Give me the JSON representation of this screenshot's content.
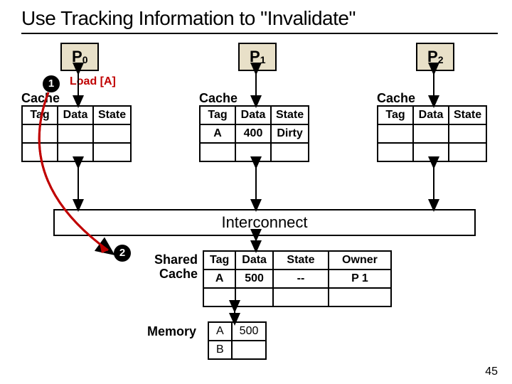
{
  "title": "Use Tracking Information to \"Invalidate\"",
  "processors": {
    "p0": "P",
    "p0_sub": "0",
    "p1": "P",
    "p1_sub": "1",
    "p2": "P",
    "p2_sub": "2"
  },
  "labels": {
    "load_a": "Load [A]",
    "cache0": "Cache",
    "cache1": "Cache",
    "cache2": "Cache",
    "interconnect": "Interconnect",
    "shared_cache": "Shared\nCache",
    "memory": "Memory"
  },
  "steps": {
    "one": "1",
    "two": "2"
  },
  "cache_headers": {
    "tag": "Tag",
    "data": "Data",
    "state": "State"
  },
  "cache0": {
    "r1_tag": "",
    "r1_data": "",
    "r1_state": "",
    "r2_tag": "",
    "r2_data": "",
    "r2_state": ""
  },
  "cache1": {
    "r1_tag": "A",
    "r1_data": "400",
    "r1_state": "Dirty",
    "r2_tag": "",
    "r2_data": "",
    "r2_state": ""
  },
  "cache2": {
    "r1_tag": "",
    "r1_data": "",
    "r1_state": "",
    "r2_tag": "",
    "r2_data": "",
    "r2_state": ""
  },
  "shared_headers": {
    "tag": "Tag",
    "data": "Data",
    "state": "State",
    "owner": "Owner"
  },
  "shared": {
    "r1_tag": "A",
    "r1_data": "500",
    "r1_state": "--",
    "r1_owner": "P 1",
    "r2_tag": "",
    "r2_data": "",
    "r2_state": "",
    "r2_owner": ""
  },
  "memory": {
    "r1_a": "A",
    "r1_b": "500",
    "r2_a": "B",
    "r2_b": ""
  },
  "slide_number": "45"
}
